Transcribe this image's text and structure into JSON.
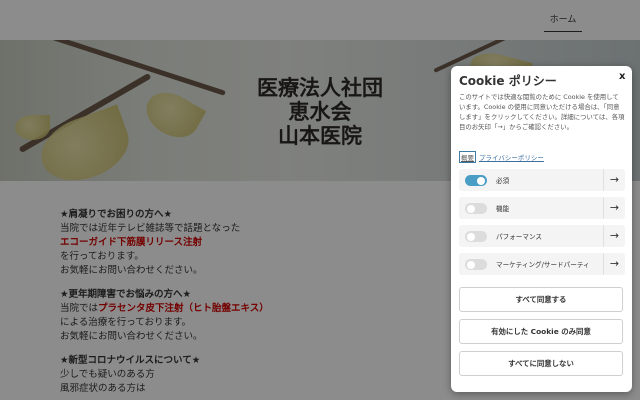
{
  "header": {
    "nav_home": "ホーム"
  },
  "hero": {
    "title_lines": [
      "医療法人社団",
      "恵水会",
      "山本医院"
    ]
  },
  "content": {
    "sections": [
      {
        "heading": "★肩凝りでお困りの方へ★",
        "lines": [
          "当院では近年テレビ雑誌等で話題となった"
        ],
        "highlight": "エコーガイド下筋膜リリース注射",
        "after": [
          "を行っております。",
          "お気軽にお問い合わせください。"
        ]
      },
      {
        "heading": "★更年期障害でお悩みの方へ★",
        "prefix": "当院では",
        "highlight": "プラセンタ皮下注射（ヒト胎盤エキス）",
        "after": [
          "による治療を行っております。",
          "お気軽にお問い合わせください。"
        ]
      },
      {
        "heading": "★新型コロナウイルスについて★",
        "after": [
          "少しでも疑いのある方",
          "風邪症状のある方は"
        ]
      }
    ]
  },
  "cookie": {
    "title": "Cookie ポリシー",
    "close": "x",
    "description": "このサイトでは快適な閲覧のために Cookie を使用しています。Cookie の使用に同意いただける場合は、「同意します」をクリックしてください。詳細については、各項目のお矢印「→」からご確認ください。",
    "overview_link": "概要",
    "privacy_link": "プライバシーポリシー",
    "categories": [
      {
        "label": "必須",
        "enabled": true
      },
      {
        "label": "機能",
        "enabled": false
      },
      {
        "label": "パフォーマンス",
        "enabled": false
      },
      {
        "label": "マーケティング/サードパーティ",
        "enabled": false
      }
    ],
    "chevron": "→",
    "buttons": {
      "accept_all": "すべて同意する",
      "accept_enabled": "有効にした Cookie のみ同意",
      "reject_all": "すべてに同意しない"
    }
  },
  "colors": {
    "toggle_on": "#4a9ec6",
    "highlight_red": "#d40000",
    "overlay": "rgba(0,0,0,0.45)"
  }
}
